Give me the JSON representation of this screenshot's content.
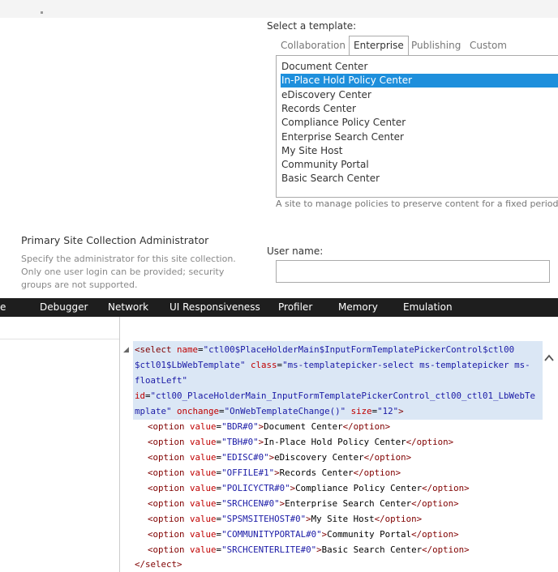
{
  "template_section": {
    "label": "Select a template:",
    "tabs": [
      {
        "label": "Collaboration",
        "active": false
      },
      {
        "label": "Enterprise",
        "active": true
      },
      {
        "label": "Publishing",
        "active": false
      },
      {
        "label": "Custom",
        "active": false
      }
    ],
    "options": [
      "Document Center",
      "In-Place Hold Policy Center",
      "eDiscovery Center",
      "Records Center",
      "Compliance Policy Center",
      "Enterprise Search Center",
      "My Site Host",
      "Community Portal",
      "Basic Search Center"
    ],
    "selected_option": "In-Place Hold Policy Center",
    "description": "A site to manage policies to preserve content for a fixed period of ti"
  },
  "admin_section": {
    "title": "Primary Site Collection Administrator",
    "description": "Specify the administrator for this site collection. Only one user login can be provided; security groups are not supported.",
    "username_label": "User name:",
    "username_value": ""
  },
  "devtools": {
    "tabs": [
      "e",
      "Debugger",
      "Network",
      "UI Responsiveness",
      "Profiler",
      "Memory",
      "Emulation"
    ],
    "select_tag": {
      "open": "<select",
      "name_attr": "name",
      "name_value_1": "\"ctl00$PlaceHolderMain$InputFormTemplatePickerControl$ctl00",
      "name_value_2": "$ctl01$LbWebTemplate\"",
      "class_attr": "class",
      "class_value_1": "\"ms-templatepicker-select ms-templatepicker ms-",
      "class_value_2": "floatLeft\"",
      "id_attr": "id",
      "id_value_1": "\"ctl00_PlaceHolderMain_InputFormTemplatePickerControl_ctl00_ctl01_LbWebTe",
      "id_value_2": "mplate\"",
      "onchange_attr": "onchange",
      "onchange_value": "\"OnWebTemplateChange()\"",
      "size_attr": "size",
      "size_value": "\"12\"",
      "close": "</select>"
    },
    "option_rows": [
      {
        "value": "\"BDR#0\"",
        "text": "Document Center"
      },
      {
        "value": "\"TBH#0\"",
        "text": "In-Place Hold Policy Center"
      },
      {
        "value": "\"EDISC#0\"",
        "text": "eDiscovery Center"
      },
      {
        "value": "\"OFFILE#1\"",
        "text": "Records Center"
      },
      {
        "value": "\"POLICYCTR#0\"",
        "text": "Compliance Policy Center"
      },
      {
        "value": "\"SRCHCEN#0\"",
        "text": "Enterprise Search Center"
      },
      {
        "value": "\"SPSMSITEHOST#0\"",
        "text": "My Site Host"
      },
      {
        "value": "\"COMMUNITYPORTAL#0\"",
        "text": "Community Portal"
      },
      {
        "value": "\"SRCHCENTERLITE#0\"",
        "text": "Basic Search Center"
      }
    ],
    "option_open": "<option",
    "option_value_attr": "value",
    "option_close": "</option>"
  },
  "colors": {
    "selection": "#1e8fdc",
    "devbar": "#1e1e1e",
    "code_highlight": "#dbe7f5"
  }
}
